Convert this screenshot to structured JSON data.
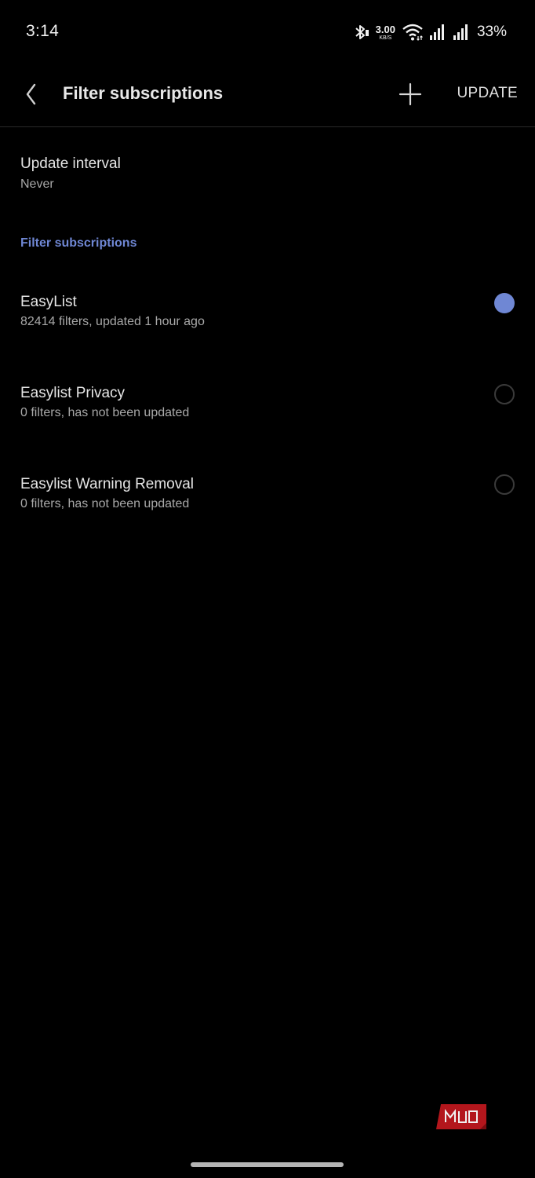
{
  "status_bar": {
    "time": "3:14",
    "net_speed_value": "3.00",
    "net_speed_unit": "KB/S",
    "battery": "33%",
    "icons": [
      "bluetooth-icon",
      "wifi-icon",
      "signal-icon",
      "signal-icon"
    ]
  },
  "app_bar": {
    "title": "Filter subscriptions",
    "update_label": "UPDATE",
    "icons": [
      "back-icon",
      "plus-icon"
    ]
  },
  "settings": {
    "update_interval": {
      "title": "Update interval",
      "value": "Never"
    }
  },
  "section": {
    "title": "Filter subscriptions"
  },
  "subscriptions": [
    {
      "name": "EasyList",
      "details": "82414 filters, updated 1 hour ago",
      "enabled": true
    },
    {
      "name": "Easylist Privacy",
      "details": "0 filters, has not been updated",
      "enabled": false
    },
    {
      "name": "Easylist Warning Removal",
      "details": "0 filters, has not been updated",
      "enabled": false
    }
  ],
  "watermark": {
    "text": "MUO"
  },
  "colors": {
    "accent": "#6f87d4",
    "background": "#000000",
    "watermark": "#b3161c"
  }
}
